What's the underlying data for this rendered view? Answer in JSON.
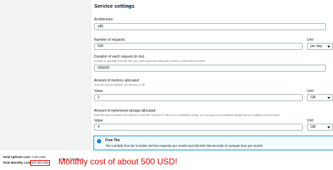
{
  "section": {
    "title": "Service settings",
    "info": "Info"
  },
  "architecture": {
    "label": "Architecture",
    "value": "x86"
  },
  "requests": {
    "label": "Number of requests",
    "value": "600",
    "unit_label": "Unit",
    "unit_value": "per day"
  },
  "duration": {
    "label": "Duration of each request (in ms)",
    "hint": "Duration is calculated from the time your code begins executing until it returns or otherwise terminates.",
    "value": "600000"
  },
  "memory": {
    "label": "Amount of memory allocated",
    "hint": "Enter the amount between 128 MB and 10 GB",
    "value_label": "Value",
    "value": "2",
    "unit_label": "Unit",
    "unit_value": "GB"
  },
  "storage": {
    "label": "Amount of ephemeral storage allocated",
    "hint": "Enter the amount between 512 MB and 10,240 MB. The first 512 MB are at no additional charge, you only pay for any additional storage that you configure for the function.",
    "value_label": "Value",
    "value": "4",
    "unit_label": "Unit",
    "unit_value": "GB"
  },
  "free_tier": {
    "icon": "info-icon",
    "title": "Free Tier",
    "text": "The Lambda free tier includes 1M free requests per month and 400,000 GB-seconds of compute time per month."
  },
  "footer": {
    "upfront_label": "Total Upfront cost:",
    "upfront_value": "0.00 USD",
    "monthly_label": "Total Monthly cost:",
    "monthly_value": "447.58 USD",
    "show_details": "Show Details"
  },
  "annotation": {
    "text": "Monthly cost of about 500 USD!",
    "color": "#e00000"
  }
}
